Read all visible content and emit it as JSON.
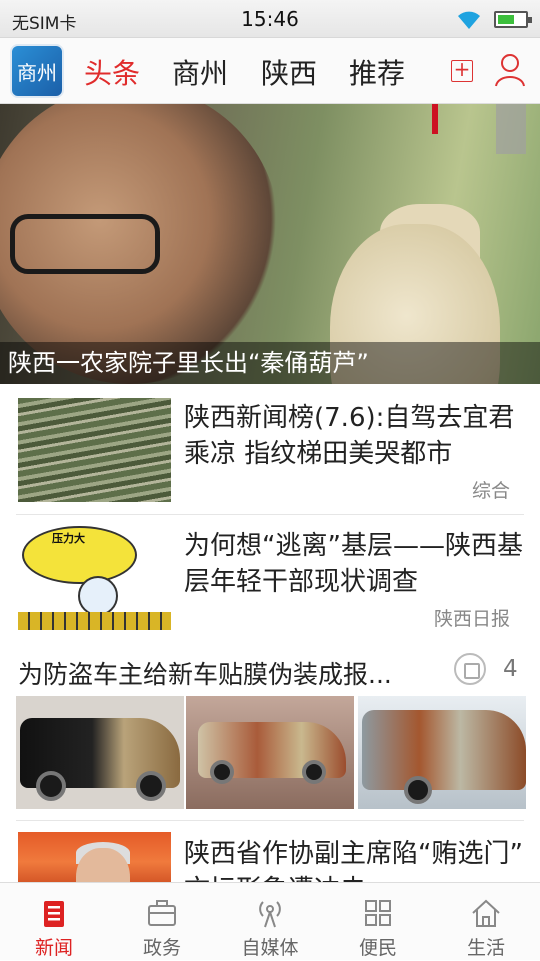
{
  "status_bar": {
    "carrier": "无SIM卡",
    "time": "15:46",
    "battery_level": 0.6
  },
  "top_nav": {
    "logo_text": "商州",
    "tabs": [
      {
        "label": "头条",
        "active": true
      },
      {
        "label": "商州",
        "active": false
      },
      {
        "label": "陕西",
        "active": false
      },
      {
        "label": "推荐",
        "active": false
      }
    ],
    "add_icon": "plus-square-icon",
    "user_icon": "user-icon",
    "accent_color": "#e02b2b"
  },
  "hero": {
    "caption": "陕西一农家院子里长出“秦俑葫芦”"
  },
  "news": [
    {
      "title": "陕西新闻榜(7.6):自驾去宜君乘凉 指纹梯田美哭都市",
      "source": "综合"
    },
    {
      "title": "为何想“逃离”基层——陕西基层年轻干部现状调查",
      "source": "陕西日报",
      "thumb_text": "压力大"
    },
    {
      "title": "陕西省作协副主席陷“贿选门” 文坛形象遭冲击",
      "source": ""
    }
  ],
  "gallery": {
    "title": "为防盗车主给新车贴膜伪装成报...",
    "count": "4",
    "icon": "image-icon"
  },
  "bottom_bar": [
    {
      "label": "新闻",
      "icon": "news-icon",
      "active": true
    },
    {
      "label": "政务",
      "icon": "briefcase-icon",
      "active": false
    },
    {
      "label": "自媒体",
      "icon": "broadcast-icon",
      "active": false
    },
    {
      "label": "便民",
      "icon": "grid-icon",
      "active": false
    },
    {
      "label": "生活",
      "icon": "home-icon",
      "active": false
    }
  ]
}
